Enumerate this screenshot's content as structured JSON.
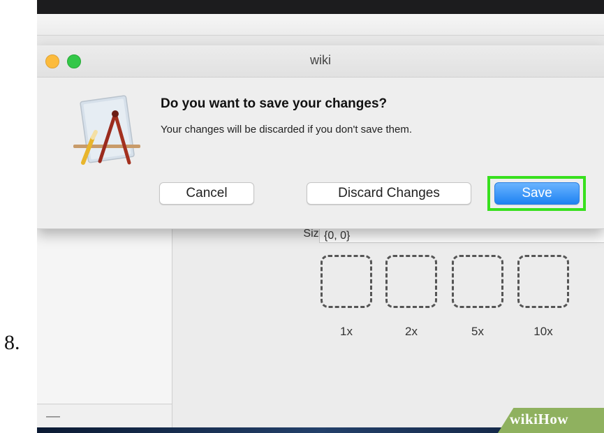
{
  "step": {
    "number": "8."
  },
  "dialog": {
    "window_title": "wiki",
    "heading": "Do you want to save your changes?",
    "message": "Your changes will be discarded if you don't save them.",
    "buttons": {
      "cancel": "Cancel",
      "discard": "Discard Changes",
      "save": "Save"
    },
    "icon": "textedit-app-icon"
  },
  "inspector": {
    "size_label": "Size:",
    "size_value": "{0, 0}",
    "slots": [
      {
        "label": "1x"
      },
      {
        "label": "2x"
      },
      {
        "label": "5x"
      },
      {
        "label": "10x"
      }
    ]
  },
  "sidebar": {
    "remove_label": "—"
  },
  "watermark": {
    "text": "wikiHow"
  },
  "colors": {
    "highlight": "#38e01e",
    "save_button": "#1e82f2",
    "traffic_yellow": "#fcbb3c",
    "traffic_green": "#33c748"
  }
}
